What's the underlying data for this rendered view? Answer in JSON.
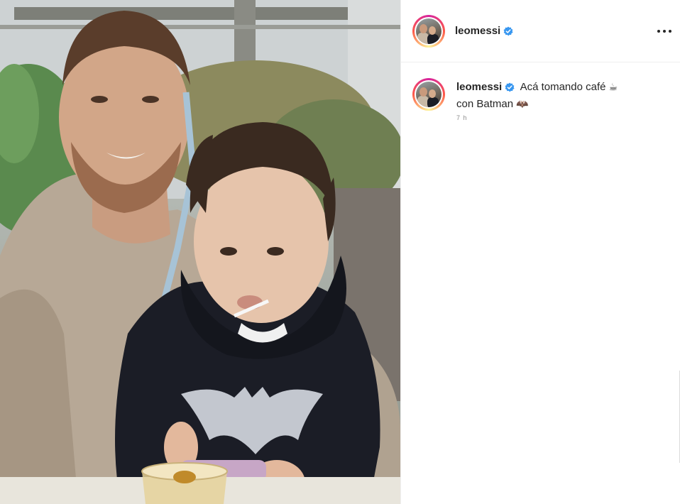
{
  "post": {
    "username": "leomessi",
    "verified": true,
    "more_icon": "more-horizontal-icon"
  },
  "caption": {
    "username": "leomessi",
    "text_line1": "Acá tomando café",
    "emoji1": "☕",
    "text_line2": "con Batman",
    "emoji2": "🦇",
    "time": "7 h"
  },
  "colors": {
    "verified_blue": "#3897f0",
    "text": "#262626",
    "muted": "#8e8e8e",
    "border": "#efefef"
  }
}
